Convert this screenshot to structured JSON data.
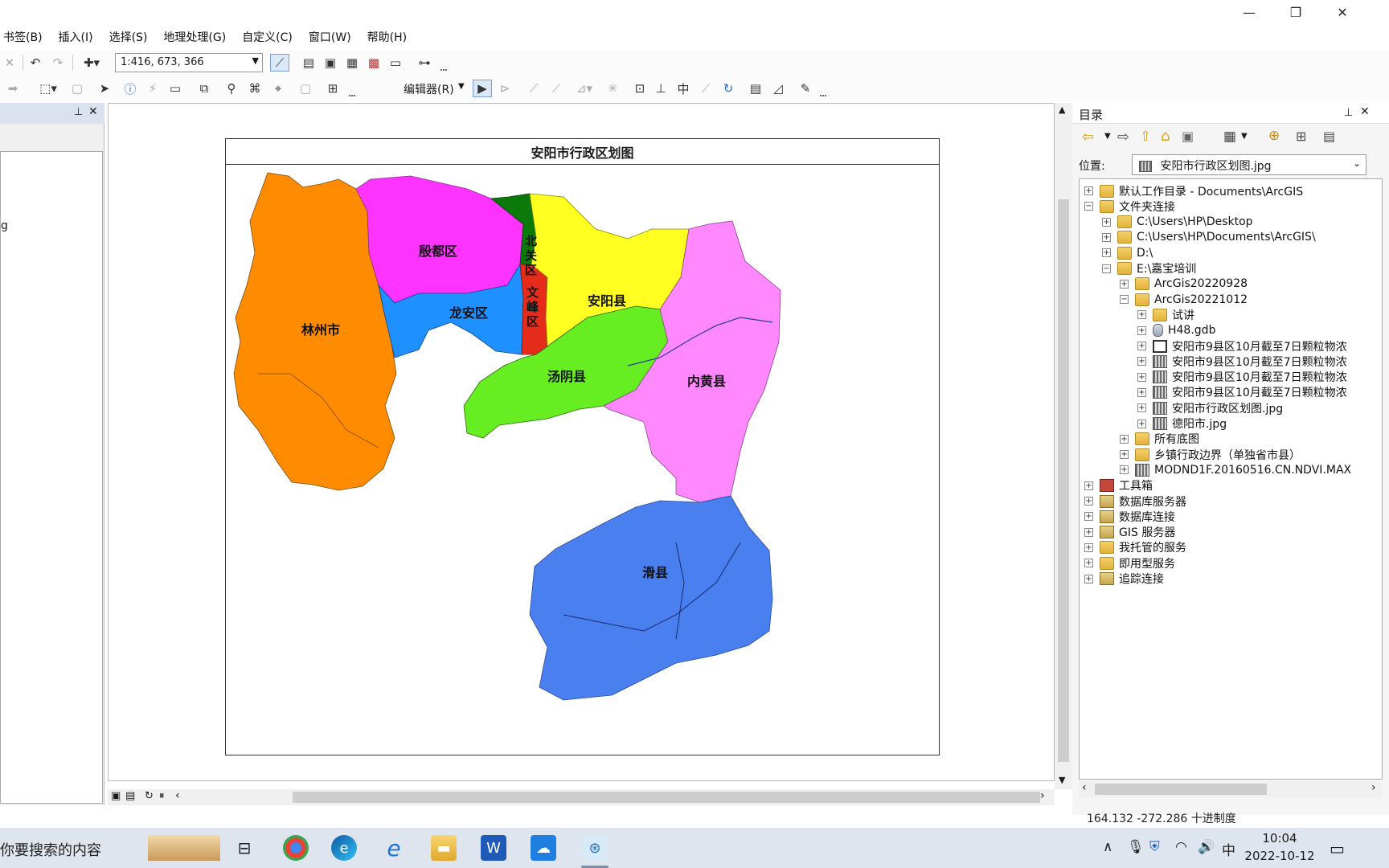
{
  "menubar": {
    "items": [
      "书签(B)",
      "插入(I)",
      "选择(S)",
      "地理处理(G)",
      "自定义(C)",
      "窗口(W)",
      "帮助(H)"
    ]
  },
  "toolbar": {
    "scale": "1:416, 673, 366",
    "editor_label": "编辑器(R)"
  },
  "toc": {
    "partial_item": "g"
  },
  "map": {
    "title": "安阳市行政区划图",
    "labels": [
      "林州市",
      "殷都区",
      "龙安区",
      "北关区",
      "文峰区",
      "安阳县",
      "汤阴县",
      "内黄县",
      "滑县"
    ],
    "colors": {
      "linzhou": "#ff8c00",
      "yindu": "#ff33ff",
      "longan": "#1e90ff",
      "beiguan": "#0b7a0b",
      "wenfeng": "#e52b1a",
      "anyang": "#ffff22",
      "tangyin": "#66ee22",
      "neihuang": "#ff88ff",
      "huaxian": "#4a7ff0"
    }
  },
  "catalog": {
    "title": "目录",
    "location_label": "位置:",
    "location_value": "安阳市行政区划图.jpg",
    "tree": [
      {
        "label": "默认工作目录 - Documents\\ArcGIS",
        "icon": "home-folder-icon",
        "level": 0,
        "exp": "+"
      },
      {
        "label": "文件夹连接",
        "icon": "folder-connections-icon",
        "level": 0,
        "exp": "−"
      },
      {
        "label": "C:\\Users\\HP\\Desktop",
        "icon": "folder-icon",
        "level": 1,
        "exp": "+"
      },
      {
        "label": "C:\\Users\\HP\\Documents\\ArcGIS\\",
        "icon": "folder-icon",
        "level": 1,
        "exp": "+"
      },
      {
        "label": "D:\\",
        "icon": "folder-icon",
        "level": 1,
        "exp": "+"
      },
      {
        "label": "E:\\嘉宝培训",
        "icon": "folder-icon",
        "level": 1,
        "exp": "−"
      },
      {
        "label": "ArcGis20220928",
        "icon": "folder-icon",
        "level": 2,
        "exp": "+"
      },
      {
        "label": "ArcGis20221012",
        "icon": "folder-icon",
        "level": 2,
        "exp": "−"
      },
      {
        "label": "试讲",
        "icon": "folder-icon",
        "level": 3,
        "exp": "+"
      },
      {
        "label": "H48.gdb",
        "icon": "geodatabase-icon",
        "level": 3,
        "exp": "+"
      },
      {
        "label": "安阳市9县区10月截至7日颗粒物浓",
        "icon": "map-document-icon",
        "level": 3,
        "exp": "+"
      },
      {
        "label": "安阳市9县区10月截至7日颗粒物浓",
        "icon": "raster-icon",
        "level": 3,
        "exp": "+"
      },
      {
        "label": "安阳市9县区10月截至7日颗粒物浓",
        "icon": "raster-icon",
        "level": 3,
        "exp": "+"
      },
      {
        "label": "安阳市9县区10月截至7日颗粒物浓",
        "icon": "raster-icon",
        "level": 3,
        "exp": "+"
      },
      {
        "label": "安阳市行政区划图.jpg",
        "icon": "raster-icon",
        "level": 3,
        "exp": "+"
      },
      {
        "label": "德阳市.jpg",
        "icon": "raster-icon",
        "level": 3,
        "exp": "+"
      },
      {
        "label": "所有底图",
        "icon": "folder-icon",
        "level": 2,
        "exp": "+"
      },
      {
        "label": "乡镇行政边界（单独省市县）",
        "icon": "folder-icon",
        "level": 2,
        "exp": "+"
      },
      {
        "label": "MODND1F.20160516.CN.NDVI.MAX",
        "icon": "raster-icon",
        "level": 2,
        "exp": "+"
      },
      {
        "label": "工具箱",
        "icon": "toolbox-icon",
        "level": 0,
        "exp": "+"
      },
      {
        "label": "数据库服务器",
        "icon": "database-server-icon",
        "level": 0,
        "exp": "+"
      },
      {
        "label": "数据库连接",
        "icon": "database-connection-icon",
        "level": 0,
        "exp": "+"
      },
      {
        "label": "GIS 服务器",
        "icon": "gis-server-icon",
        "level": 0,
        "exp": "+"
      },
      {
        "label": "我托管的服务",
        "icon": "hosted-services-icon",
        "level": 0,
        "exp": "+"
      },
      {
        "label": "即用型服务",
        "icon": "ready-services-icon",
        "level": 0,
        "exp": "+"
      },
      {
        "label": "追踪连接",
        "icon": "tracking-connection-icon",
        "level": 0,
        "exp": "+"
      }
    ]
  },
  "status": {
    "coords": "164.132  -272.286 十进制度"
  },
  "taskbar": {
    "search_text": "你要搜索的内容",
    "ime": "中",
    "time": "10:04",
    "date": "2022-10-12"
  }
}
